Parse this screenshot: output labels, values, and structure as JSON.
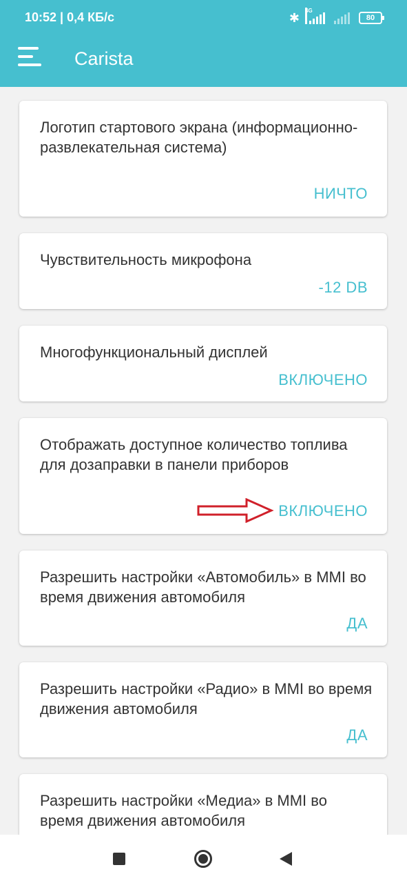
{
  "status_bar": {
    "time": "10:52 | 0,4 КБ/с",
    "network_tag": "4G",
    "battery": "80"
  },
  "app_bar": {
    "title": "Carista"
  },
  "settings": [
    {
      "title": "Логотип стартового экрана (информационно-развлекательная система)",
      "value": "НИЧТО"
    },
    {
      "title": "Чувствительность микрофона",
      "value": "-12 DB"
    },
    {
      "title": "Многофункциональный дисплей",
      "value": "ВКЛЮЧЕНО"
    },
    {
      "title": "Отображать доступное количество топлива для дозаправки в панели приборов",
      "value": "ВКЛЮЧЕНО"
    },
    {
      "title": "Разрешить настройки «Автомобиль» в MMI во время движения автомобиля",
      "value": "ДА"
    },
    {
      "title": "Разрешить настройки «Радио» в MMI во время движения автомобиля",
      "value": "ДА"
    },
    {
      "title": "Разрешить настройки «Медиа» в MMI во время движения автомобиля",
      "value": ""
    }
  ],
  "colors": {
    "accent": "#46bfcf",
    "annotation_arrow": "#d0202a"
  },
  "nav_icons": [
    "recents-square-icon",
    "home-circle-icon",
    "back-triangle-icon"
  ]
}
